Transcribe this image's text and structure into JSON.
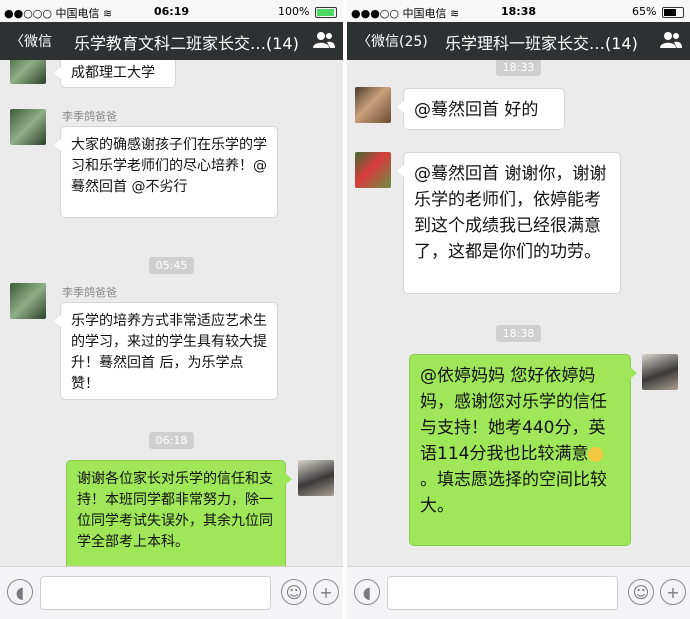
{
  "left": {
    "status": {
      "carrier": "●●○○○ 中国电信 ≋",
      "time": "06:19",
      "battery": "100%"
    },
    "nav": {
      "back": "〈微信",
      "title": "乐学教育文科二班家长交…(14)"
    },
    "messages": {
      "m0": "成都理工大学",
      "name1": "李季鸽爸爸",
      "m1": "大家的确感谢孩子们在乐学的学习和乐学老师们的尽心培养！@蓦然回首 @不劣行",
      "t1": "05:45",
      "name2": "李季鸽爸爸",
      "m2": "乐学的培养方式非常适应艺术生的学习，来过的学生具有较大提升！蓦然回首 后，为乐学点赞！",
      "t2": "06:18",
      "m3": "谢谢各位家长对乐学的信任和支持！本班同学都非常努力，除一位同学考试失误外，其余九位同学全部考上本科。"
    }
  },
  "right": {
    "status": {
      "carrier": "●●●○○ 中国电信 ≋",
      "time": "18:38",
      "battery": "65%"
    },
    "nav": {
      "back": "〈微信(25)",
      "title": "乐学理科一班家长交…(14)"
    },
    "messages": {
      "t0": "18:33",
      "m1": "@蓦然回首 好的",
      "m2": "@蓦然回首 谢谢你，谢谢乐学的老师们，依婷能考到这个成绩我已经很满意了，这都是你们的功劳。",
      "t1": "18:38",
      "m3a": "@依婷妈妈 您好依婷妈妈，感谢您对乐学的信任与支持！她考440分，英语114分我也比较满意",
      "m3b": "。填志愿选择的空间比较大。"
    }
  },
  "icons": {
    "voice": "voice-icon",
    "smiley": "emoji-icon",
    "plus": "plus-icon",
    "group": "group-icon"
  },
  "colors": {
    "nav": "#2e3132",
    "outgoing": "#9fe658",
    "background": "#ebebeb"
  }
}
